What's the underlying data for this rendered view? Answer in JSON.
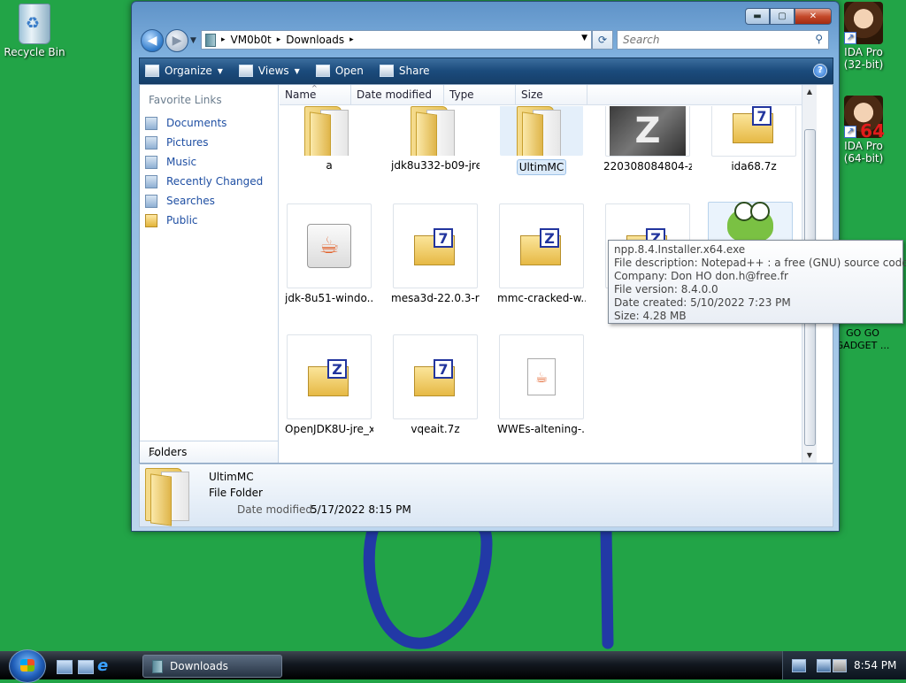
{
  "desktop": {
    "recycle_bin_label": "Recycle Bin",
    "ida32_label_line1": "IDA Pro",
    "ida32_label_line2": "(32-bit)",
    "ida64_label_line1": "IDA Pro",
    "ida64_label_line2": "(64-bit)",
    "ida64_badge": "64",
    "gogo_line1": "GO GO",
    "gogo_line2": "GADGET ..."
  },
  "window": {
    "buttons": {
      "minimize": "▬",
      "maximize": "▢",
      "close": "✕"
    },
    "address": {
      "crumbs": [
        "VM0b0t",
        "Downloads"
      ],
      "separator": "▸"
    },
    "search_placeholder": "Search",
    "toolbar": {
      "organize": "Organize",
      "views": "Views",
      "open": "Open",
      "share": "Share",
      "help": "?"
    },
    "nav_pane": {
      "title": "Favorite Links",
      "links": [
        "Documents",
        "Pictures",
        "Music",
        "Recently Changed",
        "Searches",
        "Public"
      ],
      "folders_label": "Folders"
    },
    "columns": [
      "Name",
      "Date modified",
      "Type",
      "Size"
    ],
    "items": [
      {
        "label": "a",
        "icon": "folder-icon"
      },
      {
        "label": "jdk8u332-b09-jre",
        "icon": "folder-icon"
      },
      {
        "label": "UltimMC",
        "icon": "folder-icon",
        "selected": true
      },
      {
        "label": "220308084804-z-...",
        "icon": "image-thumbnail",
        "thumb_text": "Z"
      },
      {
        "label": "ida68.7z",
        "icon": "7z-archive-icon",
        "badge": "7"
      },
      {
        "label": "jdk-8u51-windo...",
        "icon": "java-icon"
      },
      {
        "label": "mesa3d-22.0.3-re...",
        "icon": "7z-archive-icon",
        "badge": "7"
      },
      {
        "label": "mmc-cracked-w...",
        "icon": "zip-archive-icon",
        "badge": "Z"
      },
      {
        "label": "n",
        "icon": "zip-archive-icon",
        "badge": "Z"
      },
      {
        "label": "",
        "icon": "notepad-plus-plus-icon"
      },
      {
        "label": "OpenJDK8U-jre_x...",
        "icon": "zip-archive-icon",
        "badge": "Z"
      },
      {
        "label": "vqeait.7z",
        "icon": "7z-archive-icon",
        "badge": "7"
      },
      {
        "label": "WWEs-altening-...",
        "icon": "java-jar-icon"
      }
    ],
    "details": {
      "name": "UltimMC",
      "type": "File Folder",
      "modified_label": "Date modified:",
      "modified_value": "5/17/2022 8:15 PM"
    }
  },
  "tooltip": {
    "lines": [
      "npp.8.4.Installer.x64.exe",
      "File description: Notepad++ : a free (GNU) source code editor",
      "Company: Don HO don.h@free.fr",
      "File version: 8.4.0.0",
      "Date created: 5/10/2022 7:23 PM",
      "Size: 4.28 MB"
    ]
  },
  "taskbar": {
    "task_label": "Downloads",
    "clock": "8:54 PM"
  }
}
